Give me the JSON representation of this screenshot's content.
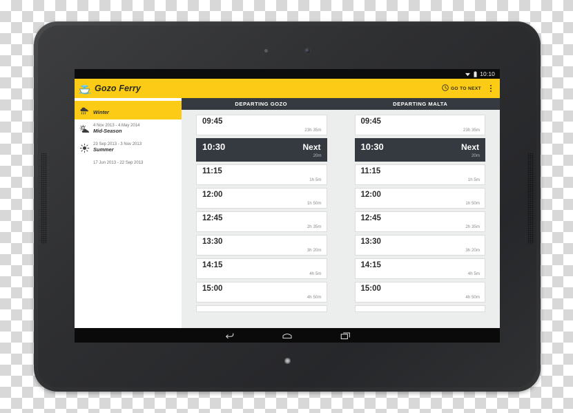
{
  "device": {
    "type": "android-tablet",
    "bezel_color": "#303133"
  },
  "status_bar": {
    "clock": "10:10",
    "icons": [
      "wifi-icon",
      "battery-icon"
    ]
  },
  "action_bar": {
    "logo_icon": "ferry-boat-logo-icon",
    "title": "Gozo Ferry",
    "go_to_next": {
      "icon": "clock-icon",
      "label": "GO TO NEXT"
    },
    "overflow_icon": "overflow-menu-icon",
    "background_color": "#fbcb16"
  },
  "sidebar": {
    "items": [
      {
        "icon": "rain-cloud-icon",
        "name": "Winter",
        "range": "4 Nov 2013 - 4 May 2014",
        "selected": true
      },
      {
        "icon": "sun-behind-cloud-icon",
        "name": "Mid-Season",
        "range": "23 Sep 2013 - 3 Nov 2013",
        "selected": false
      },
      {
        "icon": "sun-icon",
        "name": "Summer",
        "range": "17 Jun 2013 - 22 Sep 2013",
        "selected": false
      }
    ]
  },
  "schedule": {
    "accent_color": "#fbcb16",
    "header_color": "#343a40",
    "columns": [
      {
        "header": "DEPARTING GOZO",
        "trips": [
          {
            "time": "09:45",
            "eta": "23h 35m",
            "is_next": false,
            "badge": ""
          },
          {
            "time": "10:30",
            "eta": "20m",
            "is_next": true,
            "badge": "Next"
          },
          {
            "time": "11:15",
            "eta": "1h 5m",
            "is_next": false,
            "badge": ""
          },
          {
            "time": "12:00",
            "eta": "1h 50m",
            "is_next": false,
            "badge": ""
          },
          {
            "time": "12:45",
            "eta": "2h 35m",
            "is_next": false,
            "badge": ""
          },
          {
            "time": "13:30",
            "eta": "3h 20m",
            "is_next": false,
            "badge": ""
          },
          {
            "time": "14:15",
            "eta": "4h 5m",
            "is_next": false,
            "badge": ""
          },
          {
            "time": "15:00",
            "eta": "4h 50m",
            "is_next": false,
            "badge": ""
          }
        ]
      },
      {
        "header": "DEPARTING MALTA",
        "trips": [
          {
            "time": "09:45",
            "eta": "23h 35m",
            "is_next": false,
            "badge": ""
          },
          {
            "time": "10:30",
            "eta": "20m",
            "is_next": true,
            "badge": "Next"
          },
          {
            "time": "11:15",
            "eta": "1h 5m",
            "is_next": false,
            "badge": ""
          },
          {
            "time": "12:00",
            "eta": "1h 50m",
            "is_next": false,
            "badge": ""
          },
          {
            "time": "12:45",
            "eta": "2h 35m",
            "is_next": false,
            "badge": ""
          },
          {
            "time": "13:30",
            "eta": "3h 20m",
            "is_next": false,
            "badge": ""
          },
          {
            "time": "14:15",
            "eta": "4h 5m",
            "is_next": false,
            "badge": ""
          },
          {
            "time": "15:00",
            "eta": "4h 50m",
            "is_next": false,
            "badge": ""
          }
        ]
      }
    ]
  },
  "nav_bar": {
    "buttons": [
      {
        "icon": "back-icon"
      },
      {
        "icon": "home-icon"
      },
      {
        "icon": "recent-apps-icon"
      }
    ]
  }
}
